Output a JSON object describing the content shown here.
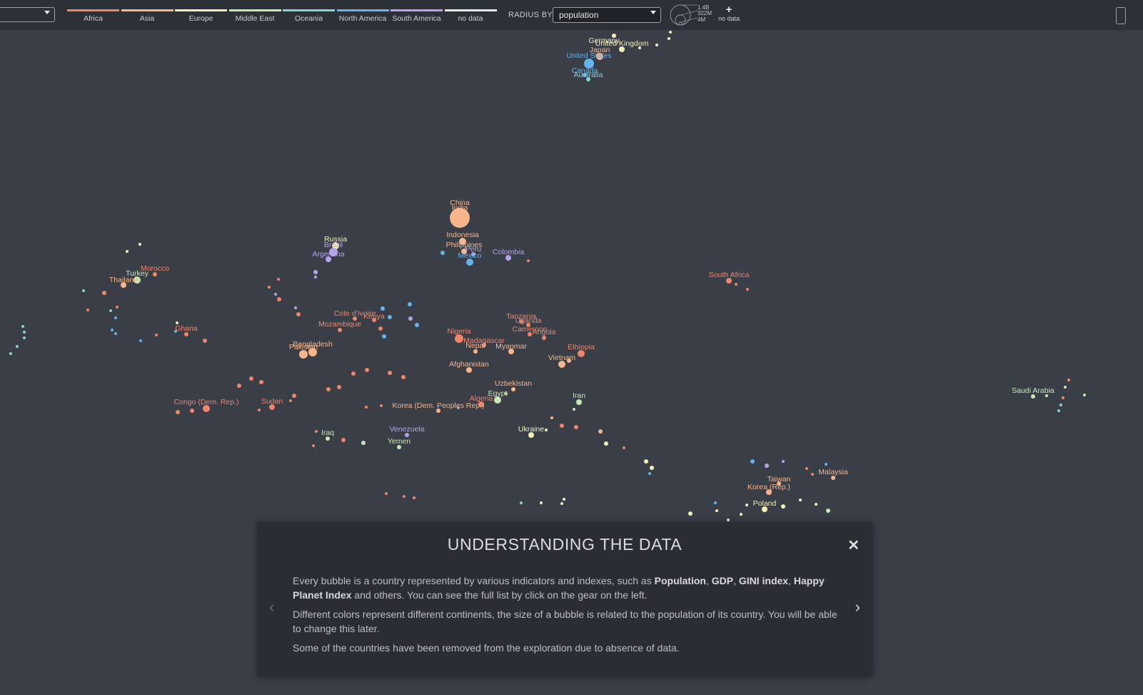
{
  "toolbar": {
    "legend": [
      {
        "label": "Africa",
        "color": "#f08569"
      },
      {
        "label": "Asia",
        "color": "#f6b58a"
      },
      {
        "label": "Europe",
        "color": "#f3f0b6"
      },
      {
        "label": "Middle East",
        "color": "#c7e9b4"
      },
      {
        "label": "Oceania",
        "color": "#86d3d8"
      },
      {
        "label": "North America",
        "color": "#62b3ee"
      },
      {
        "label": "South America",
        "color": "#b7a3ec"
      },
      {
        "label": "no data",
        "color": "#e6e6e6"
      }
    ],
    "radius_by_label": "RADIUS BY",
    "radius_by_value": "population",
    "size_legend": [
      "1.4B",
      "322M",
      "4M"
    ],
    "no_data_label": "no data"
  },
  "colors": {
    "Africa": "#f08569",
    "Asia": "#f6b58a",
    "Europe": "#f3f0b6",
    "MiddleEast": "#c7e9b4",
    "Oceania": "#86d3d8",
    "NorthAmerica": "#62b3ee",
    "SouthAmerica": "#b7a3ec",
    "NoData": "#e6e6e6"
  },
  "countries": [
    {
      "name": "China",
      "continent": "Asia"
    },
    {
      "name": "India",
      "continent": "Asia"
    },
    {
      "name": "Indonesia",
      "continent": "Asia"
    },
    {
      "name": "Philippines",
      "continent": "Asia"
    },
    {
      "name": "Peru",
      "continent": "SouthAmerica"
    },
    {
      "name": "Mexico",
      "continent": "NorthAmerica"
    },
    {
      "name": "Colombia",
      "continent": "SouthAmerica"
    },
    {
      "name": "Germany",
      "continent": "Europe"
    },
    {
      "name": "United Kingdom",
      "continent": "Europe"
    },
    {
      "name": "Japan",
      "continent": "Asia"
    },
    {
      "name": "United States",
      "continent": "NorthAmerica"
    },
    {
      "name": "Canada",
      "continent": "NorthAmerica"
    },
    {
      "name": "Australia",
      "continent": "Oceania"
    },
    {
      "name": "Russia",
      "continent": "Europe"
    },
    {
      "name": "Brazil",
      "continent": "SouthAmerica"
    },
    {
      "name": "Argentina",
      "continent": "SouthAmerica"
    },
    {
      "name": "Morocco",
      "continent": "Africa"
    },
    {
      "name": "Turkey",
      "continent": "MiddleEast"
    },
    {
      "name": "Thailand",
      "continent": "Asia"
    },
    {
      "name": "South Africa",
      "continent": "Africa"
    },
    {
      "name": "Cote d'Ivoire",
      "continent": "Africa"
    },
    {
      "name": "Kenya",
      "continent": "Africa"
    },
    {
      "name": "Mozambique",
      "continent": "Africa"
    },
    {
      "name": "Ghana",
      "continent": "Africa"
    },
    {
      "name": "Bangladesh",
      "continent": "Asia"
    },
    {
      "name": "Pakistan",
      "continent": "Asia"
    },
    {
      "name": "Tanzania",
      "continent": "Africa"
    },
    {
      "name": "Uganda",
      "continent": "Africa"
    },
    {
      "name": "Cameroon",
      "continent": "Africa"
    },
    {
      "name": "Angola",
      "continent": "Africa"
    },
    {
      "name": "Nigeria",
      "continent": "Africa"
    },
    {
      "name": "Madagascar",
      "continent": "Africa"
    },
    {
      "name": "Nepal",
      "continent": "Asia"
    },
    {
      "name": "Myanmar",
      "continent": "Asia"
    },
    {
      "name": "Ethiopia",
      "continent": "Africa"
    },
    {
      "name": "Vietnam",
      "continent": "Asia"
    },
    {
      "name": "Afghanistan",
      "continent": "Asia"
    },
    {
      "name": "Uzbekistan",
      "continent": "Asia"
    },
    {
      "name": "Egypt",
      "continent": "MiddleEast"
    },
    {
      "name": "Algeria",
      "continent": "Africa"
    },
    {
      "name": "Iran",
      "continent": "MiddleEast"
    },
    {
      "name": "Korea (Dem. Peoples Rep.)",
      "continent": "Asia"
    },
    {
      "name": "Congo (Dem. Rep.)",
      "continent": "Africa"
    },
    {
      "name": "Sudan",
      "continent": "Africa"
    },
    {
      "name": "Iraq",
      "continent": "MiddleEast"
    },
    {
      "name": "Venezuela",
      "continent": "SouthAmerica"
    },
    {
      "name": "Yemen",
      "continent": "MiddleEast"
    },
    {
      "name": "Ukraine",
      "continent": "Europe"
    },
    {
      "name": "Saudi Arabia",
      "continent": "MiddleEast"
    },
    {
      "name": "Malaysia",
      "continent": "Asia"
    },
    {
      "name": "Taiwan",
      "continent": "Asia"
    },
    {
      "name": "Korea (Rep.)",
      "continent": "Asia"
    },
    {
      "name": "Poland",
      "continent": "Europe"
    }
  ],
  "modal": {
    "title": "UNDERSTANDING THE DATA",
    "close": "✕",
    "p1_a": "Every bubble is a country represented by various indicators and indexes, such as ",
    "p1_b1": "Population",
    "p1_sep1": ", ",
    "p1_b2": "GDP",
    "p1_sep2": ", ",
    "p1_b3": "GINI index",
    "p1_sep3": ", ",
    "p1_b4": "Happy Planet Index",
    "p1_c": " and others. You can see the full list by click on the gear on the left.",
    "p2": "Different colors represent different continents, the size of a bubble is related to the population of its country. You will be able to change this later.",
    "p3": "Some of the countries have been removed from the exploration due to absence of data."
  }
}
